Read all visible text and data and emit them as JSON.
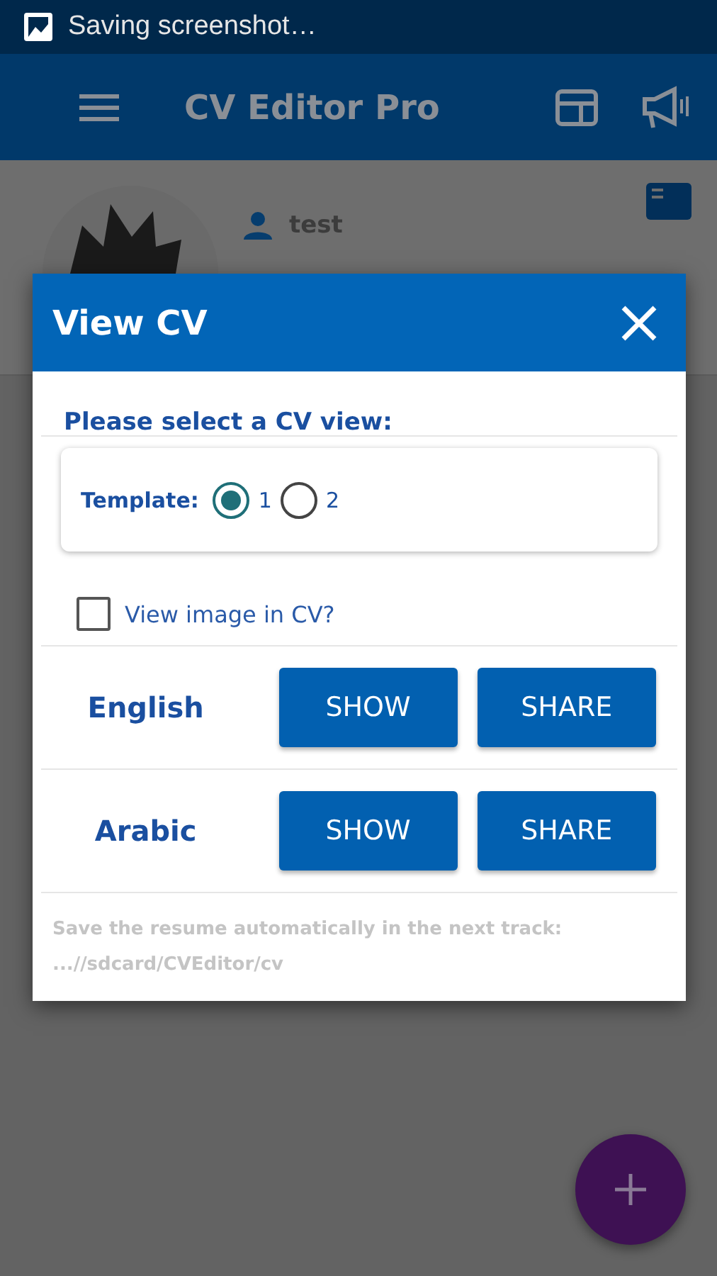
{
  "status_bar": {
    "text": "Saving screenshot…"
  },
  "app_bar": {
    "title": "CV Editor Pro"
  },
  "profile": {
    "name": "test"
  },
  "dialog": {
    "title": "View CV",
    "prompt": "Please select a CV view:",
    "template": {
      "label": "Template:",
      "options": [
        {
          "label": "1",
          "selected": true
        },
        {
          "label": "2",
          "selected": false
        }
      ]
    },
    "image_option": {
      "label": "View image in CV?",
      "checked": false
    },
    "languages": [
      {
        "name": "English",
        "buttons": [
          "SHOW",
          "SHARE"
        ]
      },
      {
        "name": "Arabic",
        "buttons": [
          "SHOW",
          "SHARE"
        ]
      }
    ],
    "footer": [
      "Save the resume automatically in the next track:",
      "...//sdcard/CVEditor/cv"
    ]
  }
}
